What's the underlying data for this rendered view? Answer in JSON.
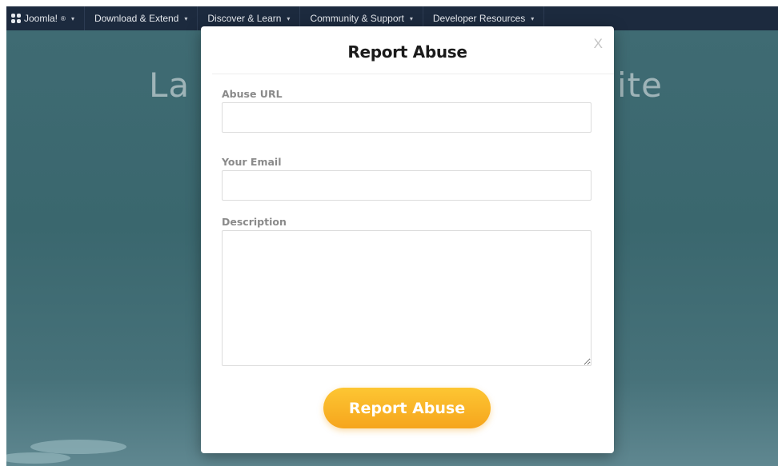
{
  "navbar": {
    "brand_label": "Joomla!",
    "brand_mark": "®",
    "items": [
      {
        "label": "Download & Extend"
      },
      {
        "label": "Discover & Learn"
      },
      {
        "label": "Community & Support"
      },
      {
        "label": "Developer Resources"
      }
    ],
    "caret_icon": "▾"
  },
  "hero": {
    "title_left": "La",
    "title_right": "ite"
  },
  "modal": {
    "title": "Report Abuse",
    "close_label": "X",
    "fields": {
      "abuse_url": {
        "label": "Abuse URL",
        "value": "",
        "placeholder": ""
      },
      "email": {
        "label": "Your Email",
        "value": "",
        "placeholder": ""
      },
      "description": {
        "label": "Description",
        "value": "",
        "placeholder": ""
      }
    },
    "submit_label": "Report Abuse"
  },
  "colors": {
    "navbar_bg": "#1c2a3e",
    "hero_bg": "#3f6b73",
    "button_top": "#fdc633",
    "button_bottom": "#f6a51d"
  }
}
